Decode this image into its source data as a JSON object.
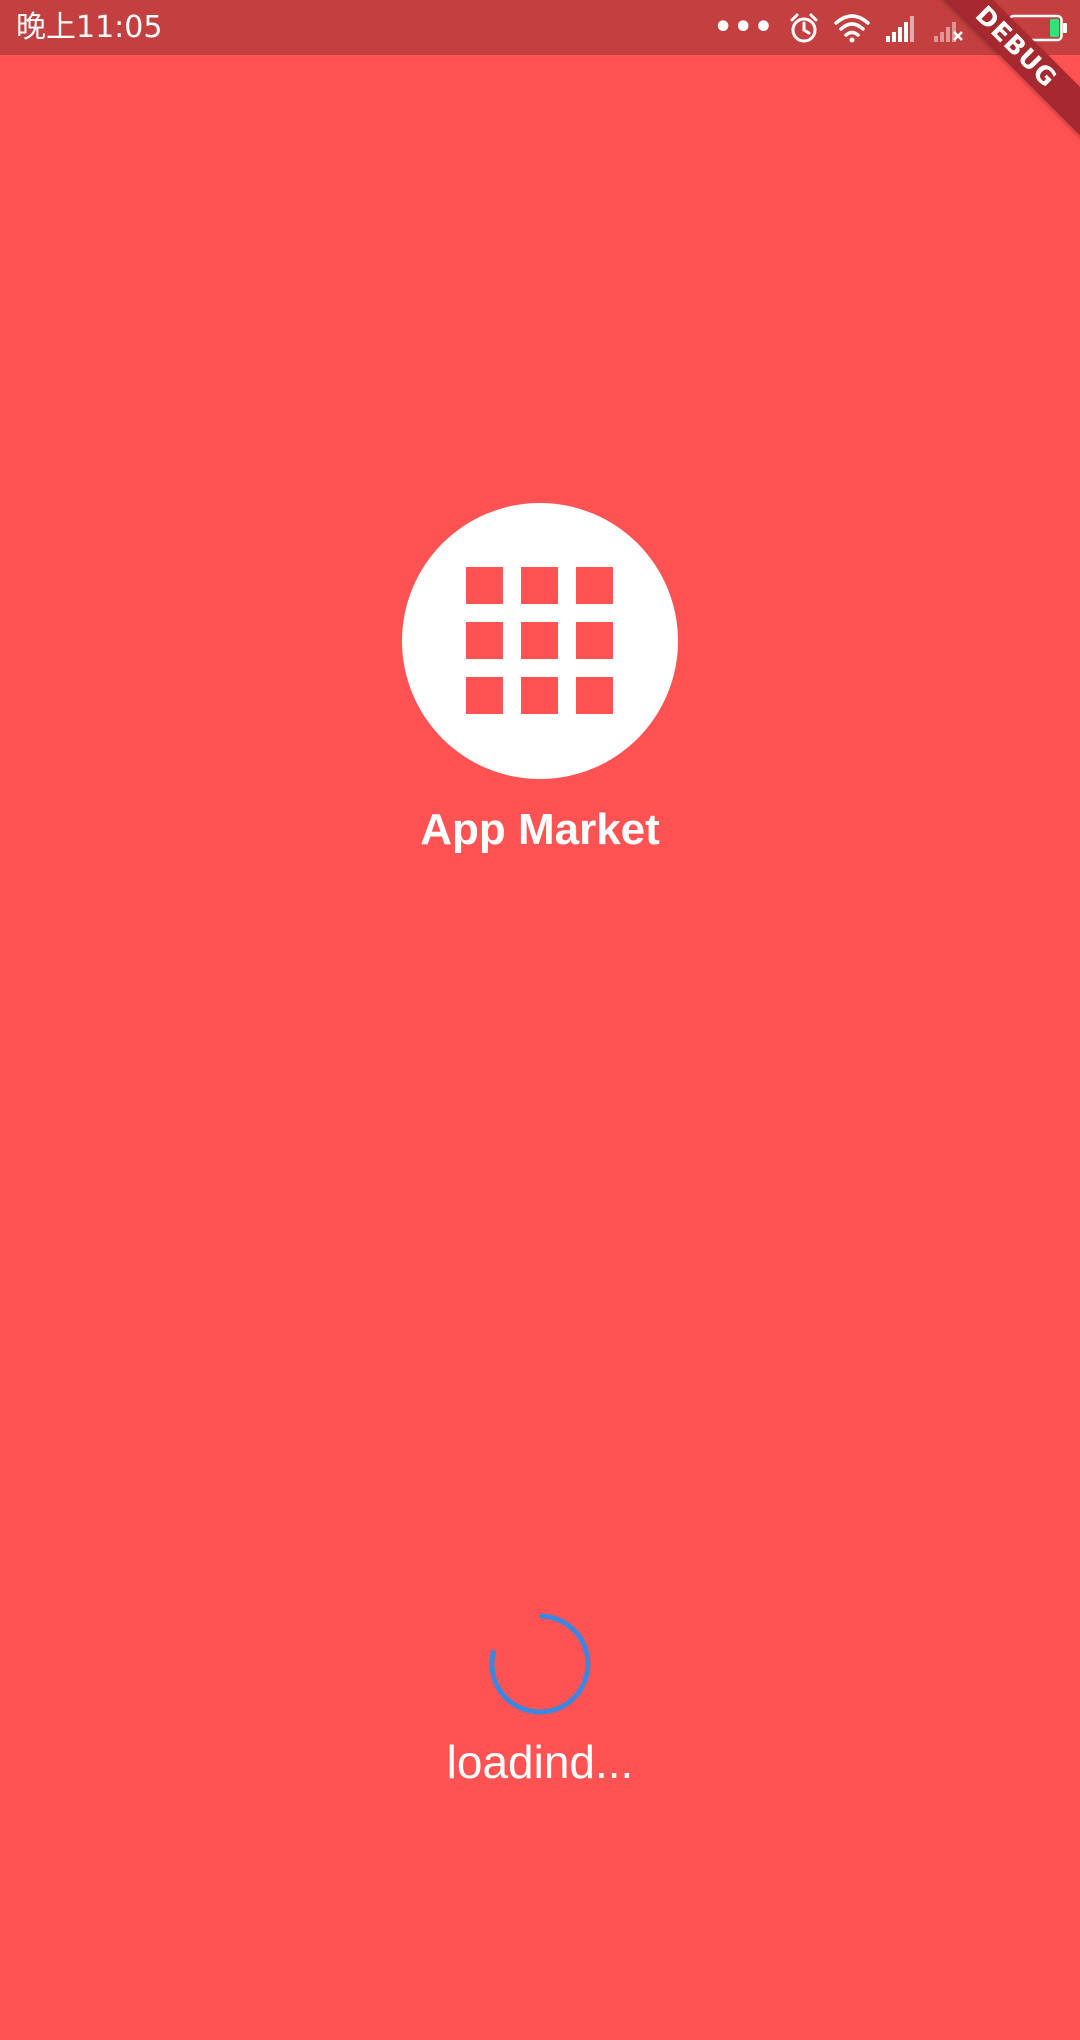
{
  "status_bar": {
    "time": "晚上11:05",
    "dots": "•••",
    "icons": [
      "alarm-icon",
      "wifi-icon",
      "signal-icon",
      "signal-no-sim-icon",
      "charging-icon",
      "battery-icon"
    ],
    "battery_level": 0.2,
    "battery_color": "#33E07A"
  },
  "debug_banner": {
    "label": "DEBUG",
    "color": "#A5292E"
  },
  "splash": {
    "background": "#FF5252",
    "logo_icon": "apps-grid-icon",
    "title": "App Market"
  },
  "loading": {
    "label": "loadind...",
    "spinner_color": "#3D86E0"
  }
}
